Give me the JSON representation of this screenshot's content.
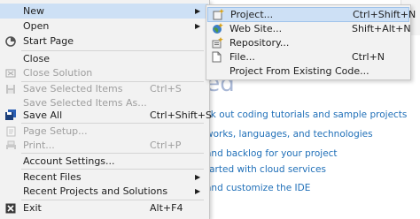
{
  "background": {
    "heading": "ted",
    "links": [
      "ck out coding tutorials and sample projects",
      "works, languages, and technologies",
      "and backlog for your project",
      "tarted with cloud services",
      "and customize the IDE"
    ]
  },
  "file_menu": {
    "new": "New",
    "open": "Open",
    "start_page": "Start Page",
    "close": "Close",
    "close_solution": "Close Solution",
    "save_selected": "Save Selected Items",
    "save_selected_shortcut": "Ctrl+S",
    "save_selected_as": "Save Selected Items As...",
    "save_all": "Save All",
    "save_all_shortcut": "Ctrl+Shift+S",
    "page_setup": "Page Setup...",
    "print": "Print...",
    "print_shortcut": "Ctrl+P",
    "account_settings": "Account Settings...",
    "recent_files": "Recent Files",
    "recent_projects": "Recent Projects and Solutions",
    "exit": "Exit",
    "exit_shortcut": "Alt+F4"
  },
  "new_submenu": {
    "project": "Project...",
    "project_shortcut": "Ctrl+Shift+N",
    "website": "Web Site...",
    "website_shortcut": "Shift+Alt+N",
    "repository": "Repository...",
    "file": "File...",
    "file_shortcut": "Ctrl+N",
    "project_from_code": "Project From Existing Code..."
  },
  "colors": {
    "highlight": "#cde0f5",
    "menu_bg": "#f2f2f2",
    "link": "#1f6fb8",
    "disabled": "#9e9e9e"
  }
}
